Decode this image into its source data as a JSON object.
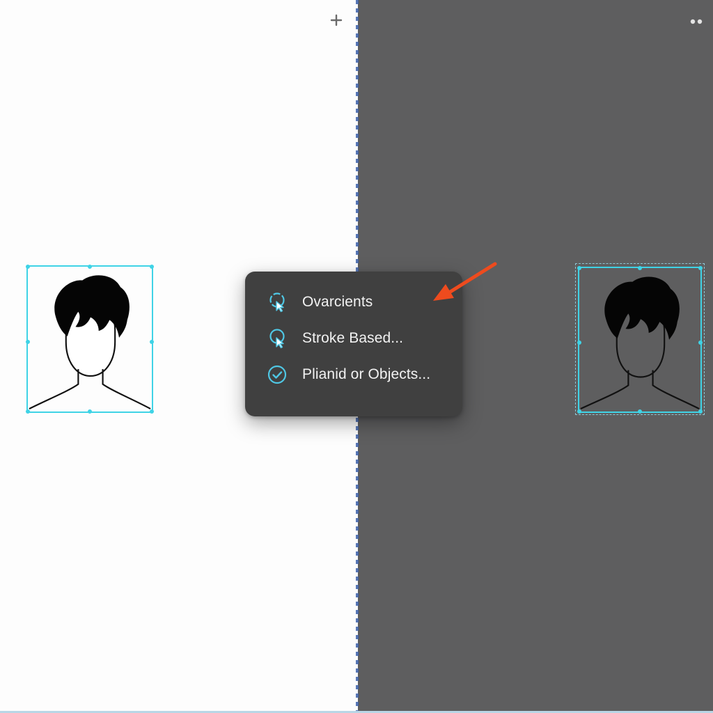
{
  "toolbar": {
    "add_icon": "plus-icon",
    "more_icon": "more-dots-icon"
  },
  "colors": {
    "left_background": "#fdfdfd",
    "right_background": "#5e5e5f",
    "selection_accent": "#3fd3e6",
    "menu_background": "#404040",
    "menu_text": "#f2f2f2",
    "annotation_arrow": "#ee4b1e",
    "divider": "#3b5fa8"
  },
  "canvas": {
    "left_object_icon": "person-silhouette-icon",
    "right_object_icon": "person-silhouette-icon"
  },
  "context_menu": {
    "items": [
      {
        "label": "Ovarcients",
        "icon": "lasso-pointer-icon"
      },
      {
        "label": "Stroke Based...",
        "icon": "stroke-pointer-icon"
      },
      {
        "label": "Plianid or Objects...",
        "icon": "check-circle-icon"
      }
    ]
  },
  "annotation": {
    "icon": "red-arrow-icon"
  }
}
